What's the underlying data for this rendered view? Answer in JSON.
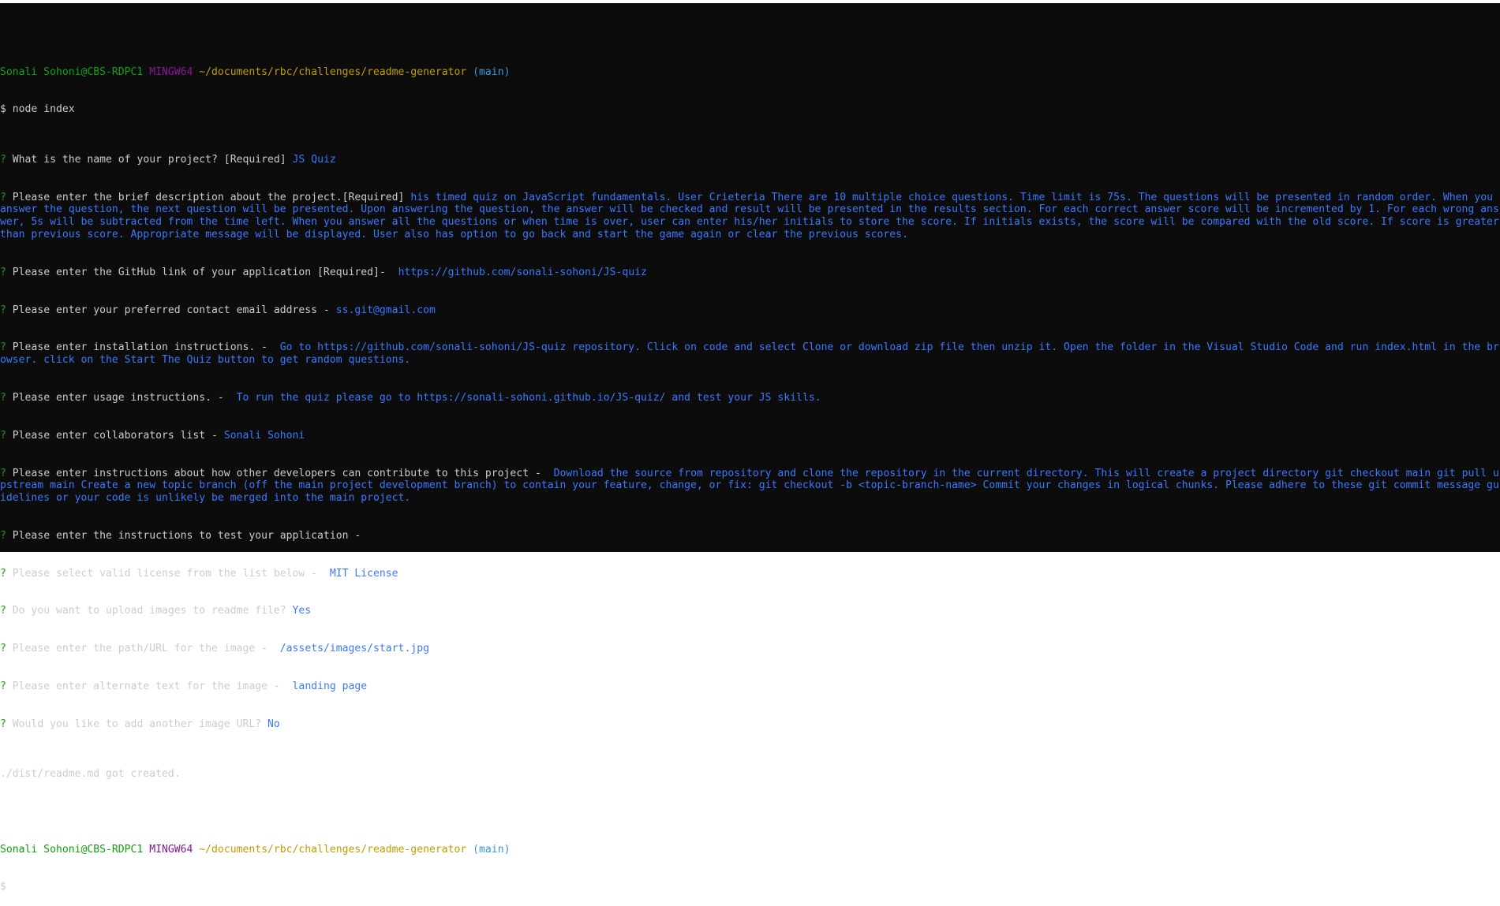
{
  "prompt": {
    "user_host": "Sonali Sohoni@CBS-RDPC1",
    "shell": "MINGW64",
    "path": "~/documents/rbc/challenges/readme-generator",
    "branch": "(main)",
    "dollar": "$"
  },
  "command": "node index",
  "qmark": "?",
  "qa": [
    {
      "q": "What is the name of your project? [Required]",
      "a": "JS Quiz"
    },
    {
      "q": "Please enter the brief description about the project.[Required]",
      "a": "his timed quiz on JavaScript fundamentals. User Crieteria There are 10 multiple choice questions. Time limit is 75s. The questions will be presented in random order. When you answer the question, the next question will be presented. Upon answering the question, the answer will be checked and result will be presented in the results section. For each correct answer score will be incremented by 1. For each wrong answer, 5s will be subtracted from the time left. When you answer all the questions or when time is over, user can enter his/her initials to store the score. If initials exists, the score will be compared with the old score. If score is greater than previous score. Appropriate message will be displayed. User also has option to go back and start the game again or clear the previous scores."
    },
    {
      "q": "Please enter the GitHub link of your application [Required]-",
      "a": "https://github.com/sonali-sohoni/JS-quiz"
    },
    {
      "q": "Please enter your preferred contact email address -",
      "a": "ss.git@gmail.com"
    },
    {
      "q": "Please enter installation instructions. -",
      "a": "Go to https://github.com/sonali-sohoni/JS-quiz repository. Click on code and select Clone or download zip file then unzip it. Open the folder in the Visual Studio Code and run index.html in the browser. click on the Start The Quiz button to get random questions."
    },
    {
      "q": "Please enter usage instructions. -",
      "a": "To run the quiz please go to https://sonali-sohoni.github.io/JS-quiz/ and test your JS skills."
    },
    {
      "q": "Please enter collaborators list -",
      "a": "Sonali Sohoni"
    },
    {
      "q": "Please enter instructions about how other developers can contribute to this project -",
      "a": "Download the source from repository and clone the repository in the current directory. This will create a project directory git checkout main git pull upstream main Create a new topic branch (off the main project development branch) to contain your feature, change, or fix: git checkout -b <topic-branch-name> Commit your changes in logical chunks. Please adhere to these git commit message guidelines or your code is unlikely be merged into the main project."
    },
    {
      "q": "Please enter the instructions to test your application -",
      "a": ""
    },
    {
      "q": "Please select valid license from the list below -",
      "a": "MIT License"
    },
    {
      "q": "Do you want to upload images to readme file?",
      "a": "Yes"
    },
    {
      "q": "Please enter the path/URL for the image -",
      "a": "/assets/images/start.jpg"
    },
    {
      "q": "Please enter alternate text for the image -",
      "a": "landing page"
    },
    {
      "q": "Would you like to add another image URL?",
      "a": "No"
    }
  ],
  "result": "./dist/readme.md got created."
}
